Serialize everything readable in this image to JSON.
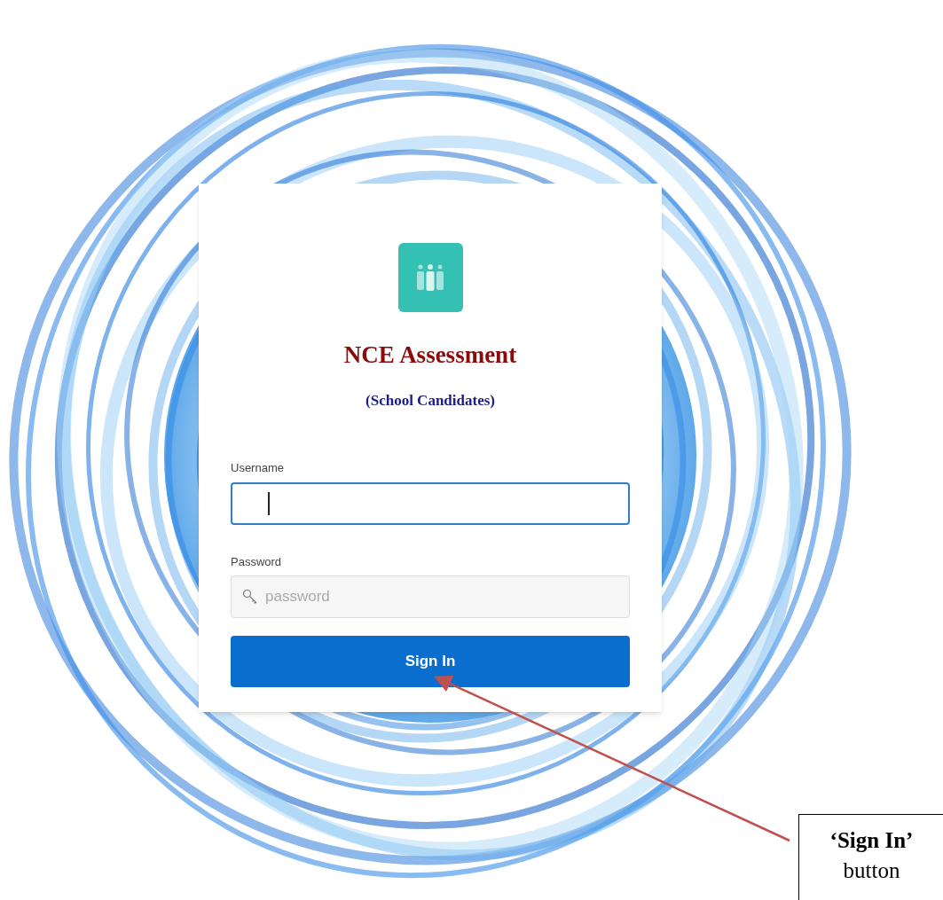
{
  "login": {
    "title": "NCE Assessment",
    "subtitle": "(School Candidates)",
    "username": {
      "label": "Username",
      "focused": true
    },
    "password": {
      "label": "Password",
      "placeholder": "password"
    },
    "sign_in_button": "Sign In"
  },
  "callout": {
    "text": "**‘Sign In’** button"
  }
}
